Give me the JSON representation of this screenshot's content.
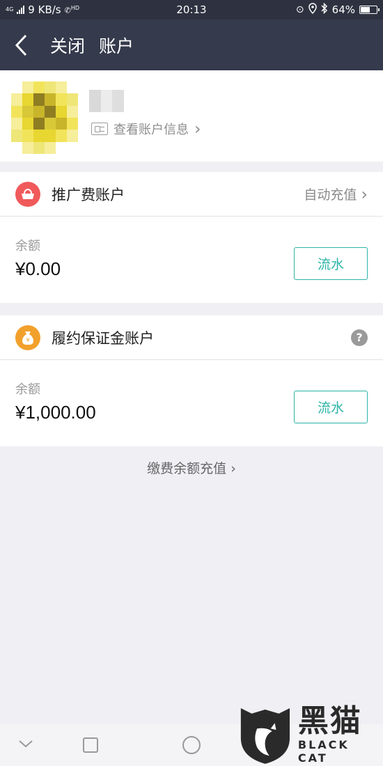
{
  "status_bar": {
    "network_tag": "4G",
    "net_speed": "9 KB/s",
    "call_tag": "HD",
    "time": "20:13",
    "battery": "64%",
    "battery_level": 0.64
  },
  "nav": {
    "close_label": "关闭",
    "title": "账户"
  },
  "profile": {
    "view_info_label": "查看账户信息",
    "view_info_chevron": "›"
  },
  "promo_account": {
    "title": "推广费账户",
    "action_label": "自动充值",
    "action_chevron": "›",
    "balance_label": "余额",
    "balance_value": "¥0.00",
    "flow_button": "流水",
    "icon_color": "#f05a5a"
  },
  "deposit_account": {
    "title": "履约保证金账户",
    "help_symbol": "?",
    "balance_label": "余额",
    "balance_value": "¥1,000.00",
    "flow_button": "流水",
    "icon_color": "#f2a02c"
  },
  "recharge_link": {
    "label": "缴费余额充值 ›"
  },
  "watermark": {
    "cn": "黑猫",
    "en": "BLACK CAT"
  },
  "colors": {
    "nav_bg": "#353a4c",
    "accent": "#2ab3a6",
    "page_bg": "#efeff4"
  }
}
